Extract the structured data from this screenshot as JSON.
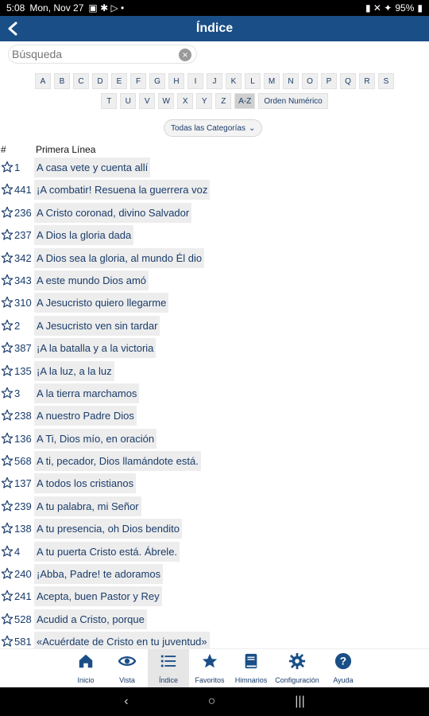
{
  "status": {
    "time": "5:08",
    "date": "Mon, Nov 27",
    "battery": "95%"
  },
  "header": {
    "title": "Índice"
  },
  "search": {
    "placeholder": "Búsqueda",
    "value": ""
  },
  "letters_row1": [
    "A",
    "B",
    "C",
    "D",
    "E",
    "F",
    "G",
    "H",
    "I",
    "J",
    "K",
    "L",
    "M",
    "N",
    "O",
    "P",
    "Q",
    "R",
    "S"
  ],
  "letters_row2": [
    "T",
    "U",
    "V",
    "W",
    "X",
    "Y",
    "Z",
    "A-Z",
    "Orden Numérico"
  ],
  "categories": {
    "label": "Todas las Categorías"
  },
  "columns": {
    "number": "#",
    "first_line": "Primera Línea"
  },
  "hymns": [
    {
      "num": "1",
      "line": "A casa vete y cuenta allí"
    },
    {
      "num": "441",
      "line": "¡A combatir!  Resuena la guerrera voz"
    },
    {
      "num": "236",
      "line": "A Cristo coronad, divino Salvador"
    },
    {
      "num": "237",
      "line": "A Dios la gloria dada"
    },
    {
      "num": "342",
      "line": "A Dios sea la gloria, al mundo Él dio"
    },
    {
      "num": "343",
      "line": "A este mundo Dios amó"
    },
    {
      "num": "310",
      "line": "A Jesucristo quiero llegarme"
    },
    {
      "num": "2",
      "line": "A Jesucristo ven sin tardar"
    },
    {
      "num": "387",
      "line": "¡A la batalla y a la victoria"
    },
    {
      "num": "135",
      "line": "¡A la luz, a la luz"
    },
    {
      "num": "3",
      "line": "A la tierra marchamos"
    },
    {
      "num": "238",
      "line": "A nuestro Padre Dios"
    },
    {
      "num": "136",
      "line": "A Ti, Dios mío, en oración"
    },
    {
      "num": "568",
      "line": "A ti, pecador, Dios llamándote está."
    },
    {
      "num": "137",
      "line": "A todos los cristianos"
    },
    {
      "num": "239",
      "line": "A tu palabra, mi Señor"
    },
    {
      "num": "138",
      "line": "A tu presencia, oh Dios bendito"
    },
    {
      "num": "4",
      "line": "A tu puerta Cristo está. Ábrele."
    },
    {
      "num": "240",
      "line": "¡Abba, Padre!  te adoramos"
    },
    {
      "num": "241",
      "line": "Acepta, buen Pastor y Rey"
    },
    {
      "num": "528",
      "line": "Acudid a Cristo, porque"
    },
    {
      "num": "581",
      "line": "«Acuérdate de Cristo en tu juventud»"
    }
  ],
  "nav": [
    {
      "label": "Inicio",
      "icon": "home-icon"
    },
    {
      "label": "Vista",
      "icon": "eye-icon"
    },
    {
      "label": "Índice",
      "icon": "list-icon",
      "active": true
    },
    {
      "label": "Favoritos",
      "icon": "star-icon"
    },
    {
      "label": "Himnarios",
      "icon": "book-icon"
    },
    {
      "label": "Configuración",
      "icon": "gear-icon"
    },
    {
      "label": "Ayuda",
      "icon": "help-icon"
    }
  ],
  "colors": {
    "primary": "#1a4e86",
    "text": "#1a3c6a",
    "row_bg": "#ededed"
  }
}
